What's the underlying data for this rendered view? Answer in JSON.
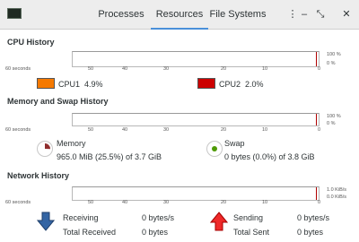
{
  "tabs": [
    {
      "label": "Processes",
      "active": false
    },
    {
      "label": "Resources",
      "active": true
    },
    {
      "label": "File Systems",
      "active": false
    }
  ],
  "window_buttons": {
    "menu": "⋮",
    "minimize": "–",
    "maximize": "⤡",
    "close": "✕"
  },
  "x_axis_labels": [
    "60 seconds",
    "50",
    "40",
    "30",
    "20",
    "10",
    "0"
  ],
  "cpu": {
    "title": "CPU History",
    "y_labels": [
      "100 %",
      "0 %"
    ],
    "cpus": [
      {
        "label": "CPU1",
        "value": "4.9%",
        "color": "#f57900",
        "usage": 0.049
      },
      {
        "label": "CPU2",
        "value": "2.0%",
        "color": "#cc0000",
        "usage": 0.02
      }
    ]
  },
  "memory": {
    "title": "Memory and Swap History",
    "y_labels": [
      "100 %",
      "0 %"
    ],
    "mem": {
      "label": "Memory",
      "detail": "965.0 MiB (25.5%) of 3.7 GiB",
      "color": "#8f2d2d",
      "fraction": 0.255
    },
    "swap": {
      "label": "Swap",
      "detail": "0 bytes (0.0%) of 3.8 GiB",
      "color": "#4e9a06",
      "fraction": 0.0
    }
  },
  "network": {
    "title": "Network History",
    "y_labels": [
      "1.0 KiB/s",
      "0.0 KiB/s"
    ],
    "receiving": {
      "label": "Receiving",
      "value": "0 bytes/s"
    },
    "total_received": {
      "label": "Total Received",
      "value": "0 bytes"
    },
    "sending": {
      "label": "Sending",
      "value": "0 bytes/s"
    },
    "total_sent": {
      "label": "Total Sent",
      "value": "0 bytes"
    },
    "colors": {
      "receive": "#3465a4",
      "send": "#cc0000"
    }
  }
}
